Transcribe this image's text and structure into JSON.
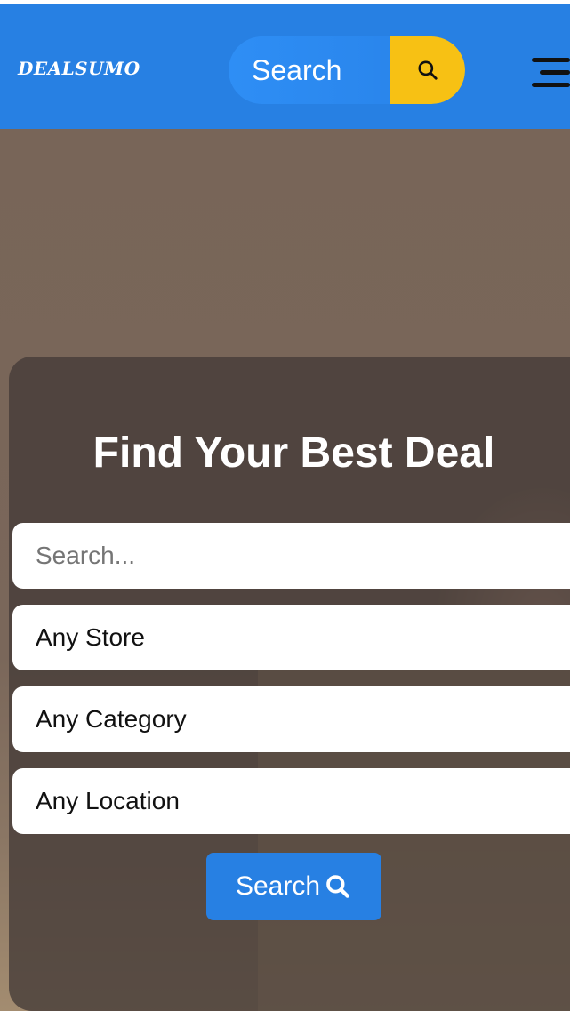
{
  "header": {
    "logo": "DEALSUMO",
    "search_label": "Search",
    "search_icon": "search-icon",
    "menu_icon": "hamburger-menu-icon"
  },
  "hero": {
    "title": "Find Your Best Deal",
    "search_placeholder": "Search...",
    "store_select": "Any Store",
    "category_select": "Any Category",
    "location_select": "Any Location",
    "submit_label": "Search",
    "submit_icon": "search-icon"
  },
  "colors": {
    "brand_blue": "#2780e3",
    "accent_yellow": "#f7c114",
    "panel_overlay": "#463c38"
  }
}
